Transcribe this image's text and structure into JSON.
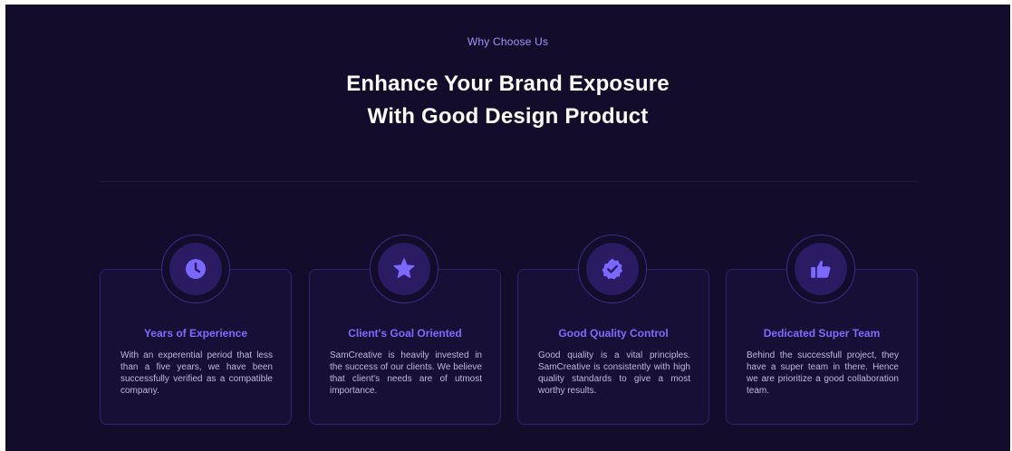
{
  "section": {
    "eyebrow": "Why Choose Us",
    "headline_line1": "Enhance Your Brand Exposure",
    "headline_line2": "With Good Design Product"
  },
  "colors": {
    "background": "#130c2b",
    "accent": "#7f6cff",
    "heading": "#ffffff"
  },
  "features": [
    {
      "icon": "clock-icon",
      "title": "Years of Experience",
      "text": "With an experential period that less than a five years, we have been successfully verified as a compatible company."
    },
    {
      "icon": "star-icon",
      "title": "Client's Goal Oriented",
      "text": "SamCreative is heavily invested in the success of our clients. We believe that client's needs are of utmost importance."
    },
    {
      "icon": "verified-badge-icon",
      "title": "Good Quality Control",
      "text": "Good quality is a vital principles. SamCreative is consistently with high quality standards to give a most worthy results."
    },
    {
      "icon": "thumbs-up-icon",
      "title": "Dedicated Super Team",
      "text": "Behind the successfull project, they have a super team in there. Hence we are prioritize a good collaboration team."
    }
  ]
}
